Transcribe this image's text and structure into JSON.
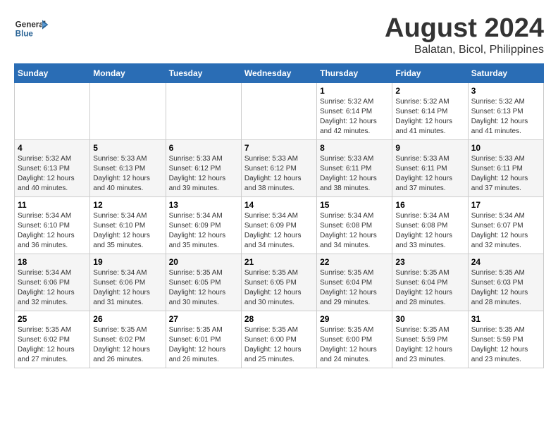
{
  "header": {
    "logo_general": "General",
    "logo_blue": "Blue",
    "title": "August 2024",
    "subtitle": "Balatan, Bicol, Philippines"
  },
  "calendar": {
    "days_of_week": [
      "Sunday",
      "Monday",
      "Tuesday",
      "Wednesday",
      "Thursday",
      "Friday",
      "Saturday"
    ],
    "weeks": [
      [
        {
          "day": "",
          "info": ""
        },
        {
          "day": "",
          "info": ""
        },
        {
          "day": "",
          "info": ""
        },
        {
          "day": "",
          "info": ""
        },
        {
          "day": "1",
          "info": "Sunrise: 5:32 AM\nSunset: 6:14 PM\nDaylight: 12 hours and 42 minutes."
        },
        {
          "day": "2",
          "info": "Sunrise: 5:32 AM\nSunset: 6:14 PM\nDaylight: 12 hours and 41 minutes."
        },
        {
          "day": "3",
          "info": "Sunrise: 5:32 AM\nSunset: 6:13 PM\nDaylight: 12 hours and 41 minutes."
        }
      ],
      [
        {
          "day": "4",
          "info": "Sunrise: 5:32 AM\nSunset: 6:13 PM\nDaylight: 12 hours and 40 minutes."
        },
        {
          "day": "5",
          "info": "Sunrise: 5:33 AM\nSunset: 6:13 PM\nDaylight: 12 hours and 40 minutes."
        },
        {
          "day": "6",
          "info": "Sunrise: 5:33 AM\nSunset: 6:12 PM\nDaylight: 12 hours and 39 minutes."
        },
        {
          "day": "7",
          "info": "Sunrise: 5:33 AM\nSunset: 6:12 PM\nDaylight: 12 hours and 38 minutes."
        },
        {
          "day": "8",
          "info": "Sunrise: 5:33 AM\nSunset: 6:11 PM\nDaylight: 12 hours and 38 minutes."
        },
        {
          "day": "9",
          "info": "Sunrise: 5:33 AM\nSunset: 6:11 PM\nDaylight: 12 hours and 37 minutes."
        },
        {
          "day": "10",
          "info": "Sunrise: 5:33 AM\nSunset: 6:11 PM\nDaylight: 12 hours and 37 minutes."
        }
      ],
      [
        {
          "day": "11",
          "info": "Sunrise: 5:34 AM\nSunset: 6:10 PM\nDaylight: 12 hours and 36 minutes."
        },
        {
          "day": "12",
          "info": "Sunrise: 5:34 AM\nSunset: 6:10 PM\nDaylight: 12 hours and 35 minutes."
        },
        {
          "day": "13",
          "info": "Sunrise: 5:34 AM\nSunset: 6:09 PM\nDaylight: 12 hours and 35 minutes."
        },
        {
          "day": "14",
          "info": "Sunrise: 5:34 AM\nSunset: 6:09 PM\nDaylight: 12 hours and 34 minutes."
        },
        {
          "day": "15",
          "info": "Sunrise: 5:34 AM\nSunset: 6:08 PM\nDaylight: 12 hours and 34 minutes."
        },
        {
          "day": "16",
          "info": "Sunrise: 5:34 AM\nSunset: 6:08 PM\nDaylight: 12 hours and 33 minutes."
        },
        {
          "day": "17",
          "info": "Sunrise: 5:34 AM\nSunset: 6:07 PM\nDaylight: 12 hours and 32 minutes."
        }
      ],
      [
        {
          "day": "18",
          "info": "Sunrise: 5:34 AM\nSunset: 6:06 PM\nDaylight: 12 hours and 32 minutes."
        },
        {
          "day": "19",
          "info": "Sunrise: 5:34 AM\nSunset: 6:06 PM\nDaylight: 12 hours and 31 minutes."
        },
        {
          "day": "20",
          "info": "Sunrise: 5:35 AM\nSunset: 6:05 PM\nDaylight: 12 hours and 30 minutes."
        },
        {
          "day": "21",
          "info": "Sunrise: 5:35 AM\nSunset: 6:05 PM\nDaylight: 12 hours and 30 minutes."
        },
        {
          "day": "22",
          "info": "Sunrise: 5:35 AM\nSunset: 6:04 PM\nDaylight: 12 hours and 29 minutes."
        },
        {
          "day": "23",
          "info": "Sunrise: 5:35 AM\nSunset: 6:04 PM\nDaylight: 12 hours and 28 minutes."
        },
        {
          "day": "24",
          "info": "Sunrise: 5:35 AM\nSunset: 6:03 PM\nDaylight: 12 hours and 28 minutes."
        }
      ],
      [
        {
          "day": "25",
          "info": "Sunrise: 5:35 AM\nSunset: 6:02 PM\nDaylight: 12 hours and 27 minutes."
        },
        {
          "day": "26",
          "info": "Sunrise: 5:35 AM\nSunset: 6:02 PM\nDaylight: 12 hours and 26 minutes."
        },
        {
          "day": "27",
          "info": "Sunrise: 5:35 AM\nSunset: 6:01 PM\nDaylight: 12 hours and 26 minutes."
        },
        {
          "day": "28",
          "info": "Sunrise: 5:35 AM\nSunset: 6:00 PM\nDaylight: 12 hours and 25 minutes."
        },
        {
          "day": "29",
          "info": "Sunrise: 5:35 AM\nSunset: 6:00 PM\nDaylight: 12 hours and 24 minutes."
        },
        {
          "day": "30",
          "info": "Sunrise: 5:35 AM\nSunset: 5:59 PM\nDaylight: 12 hours and 23 minutes."
        },
        {
          "day": "31",
          "info": "Sunrise: 5:35 AM\nSunset: 5:59 PM\nDaylight: 12 hours and 23 minutes."
        }
      ]
    ]
  }
}
